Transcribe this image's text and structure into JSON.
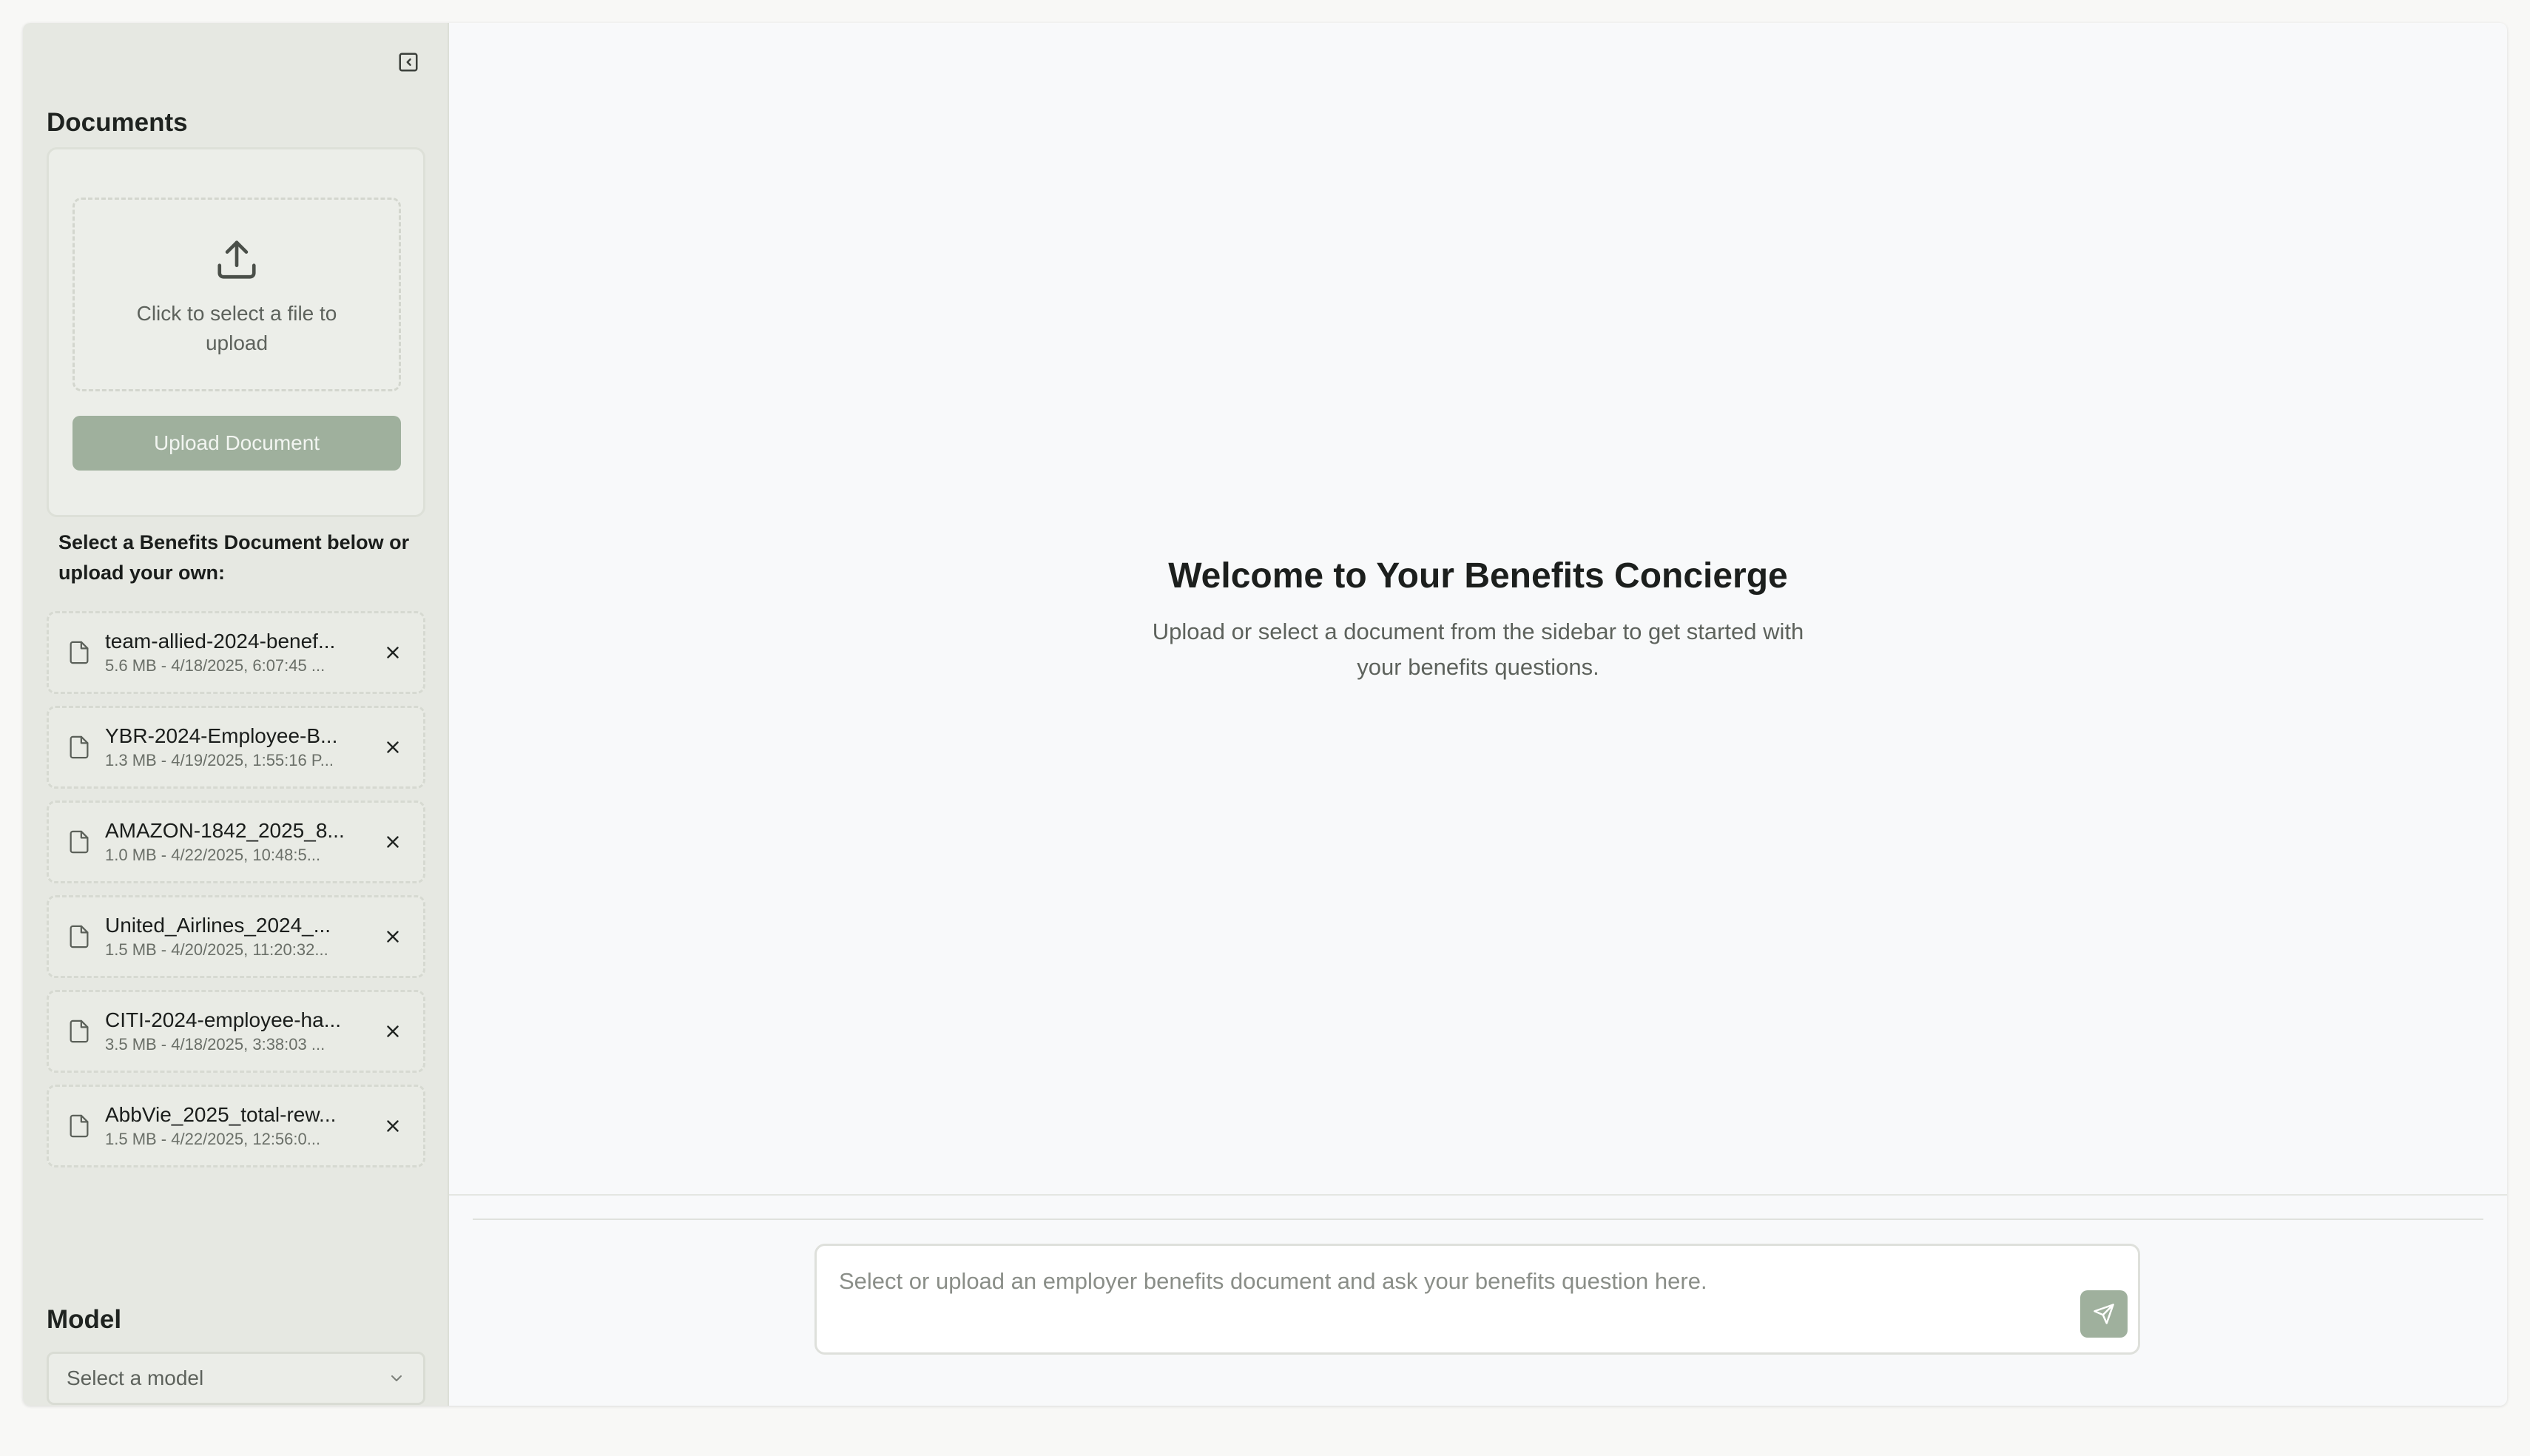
{
  "sidebar": {
    "title": "Documents",
    "upload": {
      "dropzone_text": "Click to select a file to upload",
      "button_label": "Upload Document"
    },
    "select_hint": "Select a Benefits Document below or upload your own:",
    "documents": [
      {
        "name": "team-allied-2024-benef...",
        "meta": "5.6 MB - 4/18/2025, 6:07:45 ..."
      },
      {
        "name": "YBR-2024-Employee-B...",
        "meta": "1.3 MB - 4/19/2025, 1:55:16 P..."
      },
      {
        "name": "AMAZON-1842_2025_8...",
        "meta": "1.0 MB - 4/22/2025, 10:48:5..."
      },
      {
        "name": "United_Airlines_2024_...",
        "meta": "1.5 MB - 4/20/2025, 11:20:32..."
      },
      {
        "name": "CITI-2024-employee-ha...",
        "meta": "3.5 MB - 4/18/2025, 3:38:03 ..."
      },
      {
        "name": "AbbVie_2025_total-rew...",
        "meta": "1.5 MB - 4/22/2025, 12:56:0..."
      }
    ],
    "model": {
      "title": "Model",
      "placeholder": "Select a model"
    }
  },
  "main": {
    "welcome_title": "Welcome to Your Benefits Concierge",
    "welcome_subtitle": "Upload or select a document from the sidebar to get started with your benefits questions.",
    "chat": {
      "placeholder": "Select or upload an employer benefits document and ask your benefits question here."
    }
  },
  "icons": {
    "collapse": "panel-collapse-icon",
    "upload": "upload-icon",
    "file": "file-icon",
    "remove": "close-icon",
    "chevron": "chevron-down-icon",
    "send": "send-icon"
  },
  "colors": {
    "sidebar_bg": "#e6e8e2",
    "accent": "#9fb09d",
    "main_bg": "#f8f9fa"
  }
}
